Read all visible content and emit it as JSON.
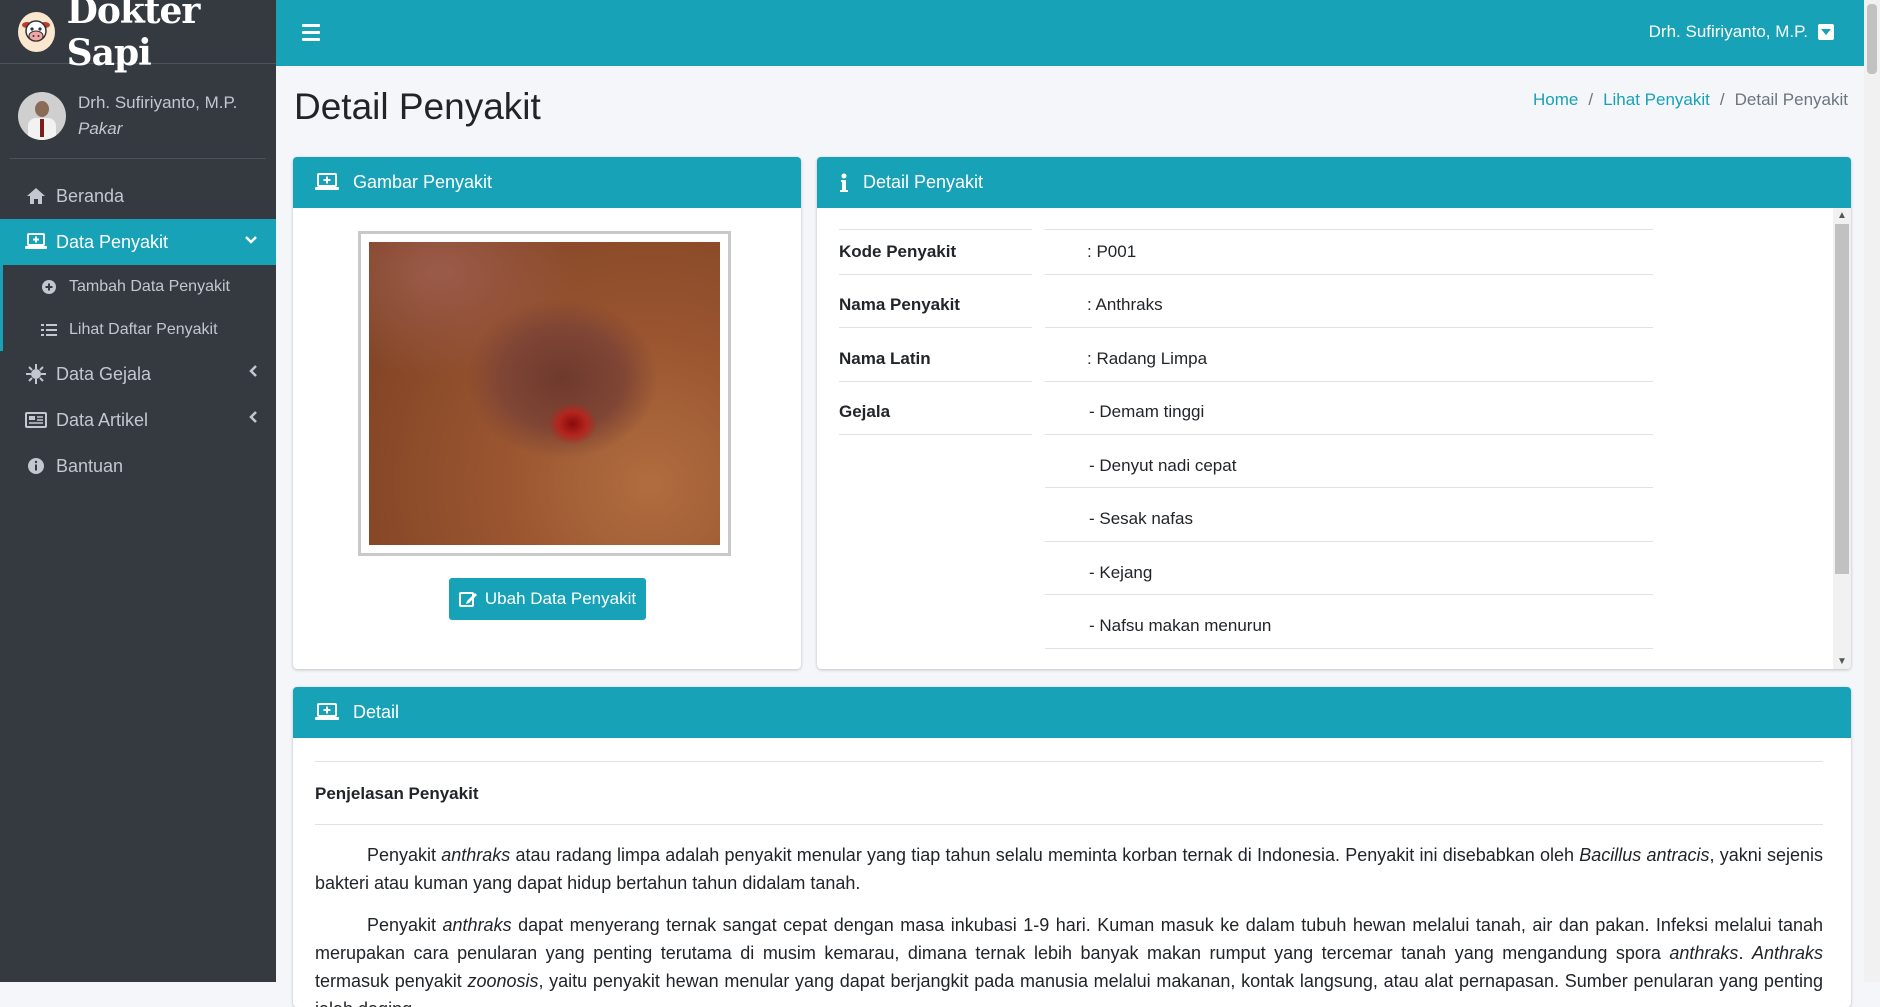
{
  "brand": {
    "name": "Dokter Sapi"
  },
  "user": {
    "name": "Drh. Sufiriyanto, M.P.",
    "role": "Pakar"
  },
  "sidebar": {
    "items": [
      {
        "label": "Beranda"
      },
      {
        "label": "Data Penyakit"
      },
      {
        "label": "Tambah Data Penyakit"
      },
      {
        "label": "Lihat Daftar Penyakit"
      },
      {
        "label": "Data Gejala"
      },
      {
        "label": "Data Artikel"
      },
      {
        "label": "Bantuan"
      }
    ]
  },
  "topbar": {
    "user": "Drh. Sufiriyanto, M.P."
  },
  "page": {
    "title": "Detail Penyakit"
  },
  "breadcrumb": {
    "home": "Home",
    "list": "Lihat Penyakit",
    "current": "Detail Penyakit"
  },
  "image_card": {
    "title": "Gambar Penyakit",
    "edit_label": "Ubah Data Penyakit"
  },
  "detail_card": {
    "title": "Detail Penyakit",
    "kode_label": "Kode Penyakit",
    "kode_value": ": P001",
    "nama_label": "Nama Penyakit",
    "nama_value": ": Anthraks",
    "latin_label": "Nama Latin",
    "latin_value": ": Radang Limpa",
    "gejala_label": "Gejala",
    "gejala": [
      "- Demam tinggi",
      "- Denyut nadi cepat",
      "- Sesak nafas",
      "- Kejang",
      "- Nafsu makan menurun"
    ]
  },
  "bottom_card": {
    "title": "Detail",
    "section_title": "Penjelasan Penyakit",
    "p1_a": "Penyakit ",
    "p1_em1": "anthraks",
    "p1_b": " atau radang limpa adalah penyakit menular yang tiap tahun selalu meminta korban ternak di Indonesia. Penyakit ini disebabkan oleh ",
    "p1_em2": "Bacillus antracis",
    "p1_c": ", yakni sejenis bakteri atau kuman yang dapat hidup bertahun tahun didalam tanah.",
    "p2_a": "Penyakit ",
    "p2_em1": "anthraks",
    "p2_b": " dapat menyerang ternak sangat cepat dengan masa inkubasi 1-9 hari. Kuman masuk ke dalam tubuh hewan melalui tanah, air dan pakan. Infeksi melalui tanah merupakan cara penularan yang penting terutama di musim kemarau, dimana ternak lebih banyak makan rumput yang tercemar tanah yang mengandung spora ",
    "p2_em2": "anthraks",
    "p2_c": ". ",
    "p2_em3": "Anthraks",
    "p2_d": " termasuk penyakit ",
    "p2_em4": "zoonosis",
    "p2_e": ", yaitu penyakit hewan menular yang dapat berjangkit pada manusia melalui makanan, kontak langsung, atau alat pernapasan. Sumber penularan yang penting ialah daging"
  }
}
